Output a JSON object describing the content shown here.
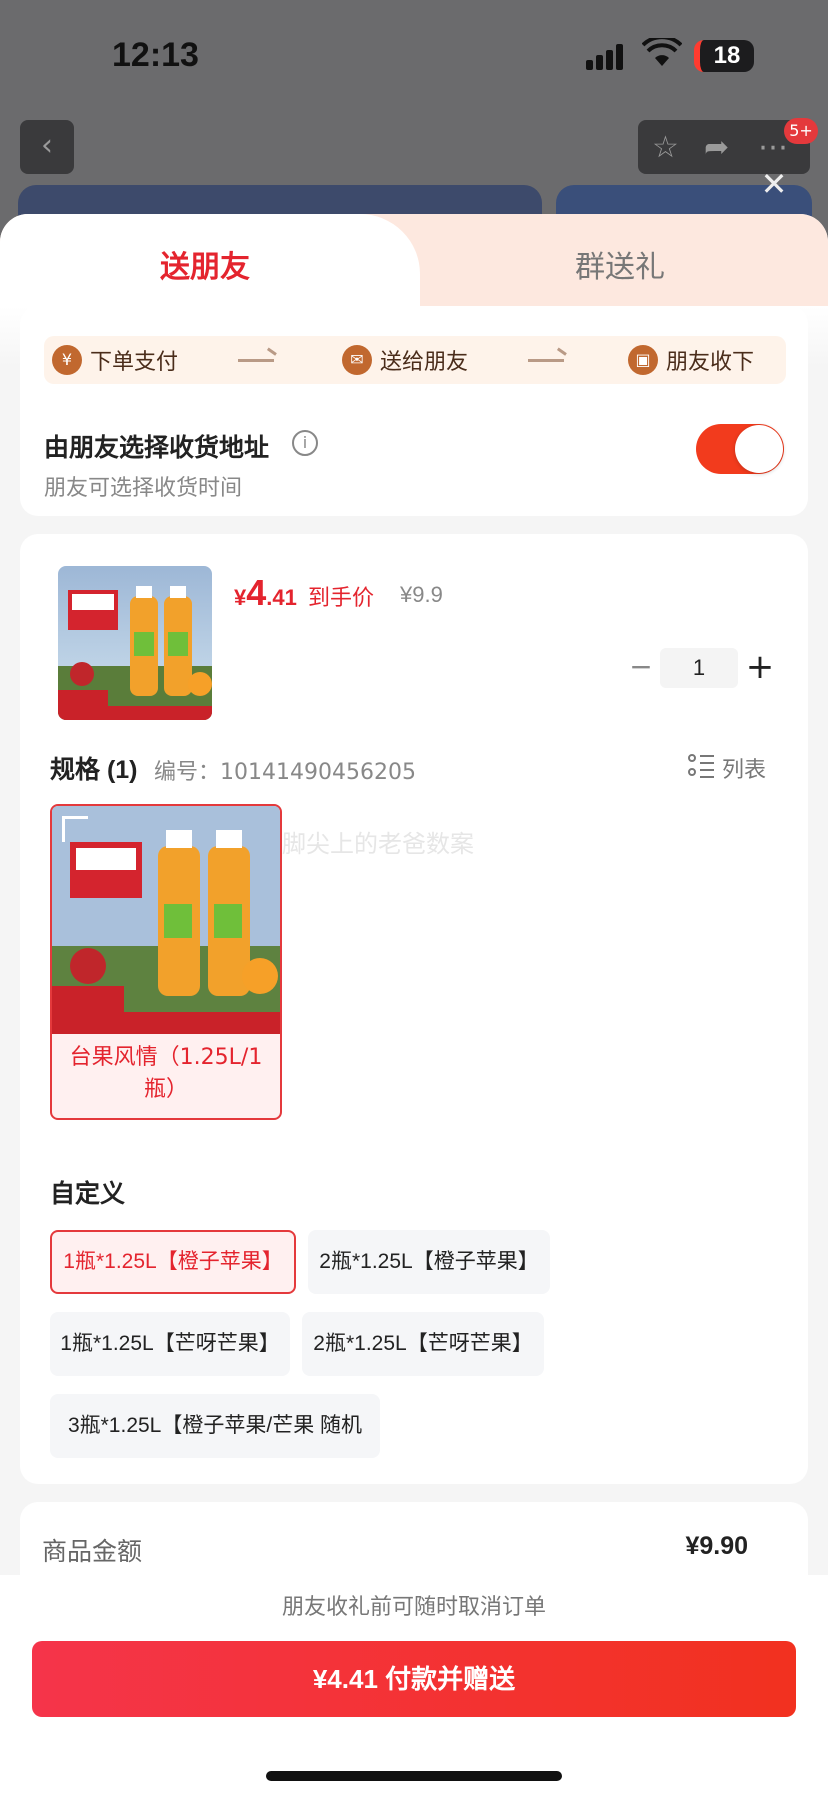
{
  "status_bar": {
    "time": "12:13",
    "battery": "18"
  },
  "background": {
    "back_icon": "chevron-left-icon",
    "badge": "5+"
  },
  "tabs": {
    "send_friend": "送朋友",
    "group_gift": "群送礼"
  },
  "steps": [
    {
      "icon": "yen-icon",
      "glyph": "¥",
      "label": "下单支付"
    },
    {
      "icon": "wechat-icon",
      "glyph": "✉",
      "label": "送给朋友"
    },
    {
      "icon": "gift-icon",
      "glyph": "▣",
      "label": "朋友收下"
    }
  ],
  "address": {
    "title": "由朋友选择收货地址",
    "subtitle": "朋友可选择收货时间",
    "toggle_on": true
  },
  "product": {
    "price_currency": "¥",
    "price_int": "4",
    "price_dec": ".41",
    "price_tag": "到手价",
    "original_price": "¥9.9",
    "quantity": "1"
  },
  "spec": {
    "title": "规格 (1)",
    "code": "编号：10141490456205",
    "list_label": "列表",
    "item_label": "台果风情（1.25L/1瓶）",
    "watermark": "脚尖上的老爸数案"
  },
  "custom": {
    "title": "自定义",
    "options": [
      "1瓶*1.25L【橙子苹果】",
      "2瓶*1.25L【橙子苹果】",
      "1瓶*1.25L【芒呀芒果】",
      "2瓶*1.25L【芒呀芒果】",
      "3瓶*1.25L【橙子苹果/芒果 随机"
    ],
    "selected_index": 0
  },
  "amount": {
    "label": "商品金额",
    "value": "¥9.90"
  },
  "footer": {
    "cancel_note": "朋友收礼前可随时取消订单",
    "pay_button": "¥4.41 付款并赠送"
  },
  "colors": {
    "accent": "#e4242e",
    "toggle": "#f23b1d",
    "step_icon": "#c1682f"
  }
}
